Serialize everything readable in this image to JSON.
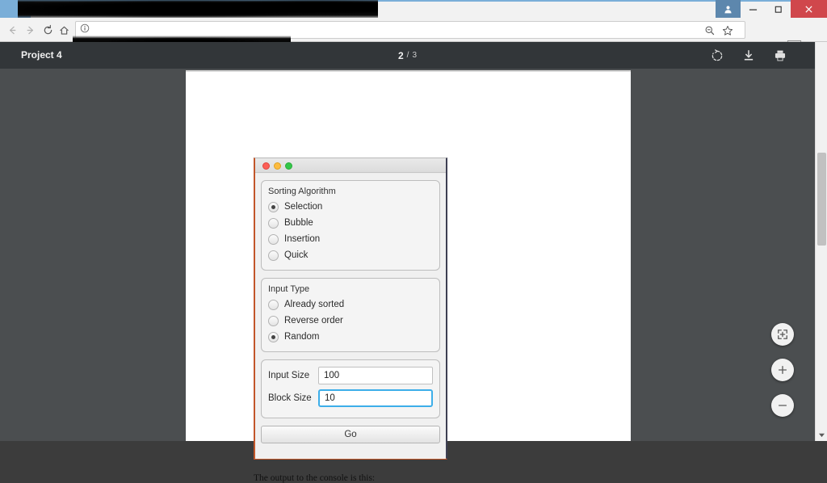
{
  "browser": {
    "tab": {
      "title": "",
      "favicon": "bookmark-icon",
      "redacted": true
    },
    "window_controls": {
      "profile": "profile-icon",
      "minimize": "–",
      "maximize": "❐",
      "close": "✕"
    },
    "toolbar": {
      "back": "back-arrow-icon",
      "forward": "forward-arrow-icon",
      "reload": "reload-icon",
      "home": "home-icon",
      "omnibox_url": "",
      "omnibox_info": "info-icon",
      "zoom_out_indicator": "zoom-out-icon",
      "bookmark_star": "star-icon",
      "extension": "extension-icon",
      "menu": "kebab-menu-icon",
      "url_redacted": true
    }
  },
  "pdf_viewer": {
    "document_title": "Project 4",
    "page_current": "2",
    "page_separator": "/",
    "page_total": "3",
    "actions": {
      "rotate": "rotate-icon",
      "download": "download-icon",
      "print": "print-icon"
    },
    "zoom_controls": {
      "fit": "fit-to-page-icon",
      "zoom_in": "+",
      "zoom_out": "−"
    },
    "page_caption": "The output to the console is this:"
  },
  "app_dialog": {
    "titlebar": {
      "close": "close-traffic-light",
      "minimize": "minimize-traffic-light",
      "maximize": "maximize-traffic-light"
    },
    "sorting_algorithm": {
      "label": "Sorting Algorithm",
      "options": [
        {
          "label": "Selection",
          "selected": true
        },
        {
          "label": "Bubble",
          "selected": false
        },
        {
          "label": "Insertion",
          "selected": false
        },
        {
          "label": "Quick",
          "selected": false
        }
      ]
    },
    "input_type": {
      "label": "Input Type",
      "options": [
        {
          "label": "Already sorted",
          "selected": false
        },
        {
          "label": "Reverse order",
          "selected": false
        },
        {
          "label": "Random",
          "selected": true
        }
      ]
    },
    "fields": [
      {
        "label": "Input Size",
        "value": "100",
        "focused": false
      },
      {
        "label": "Block Size",
        "value": "10",
        "focused": true
      }
    ],
    "submit_button": "Go"
  },
  "colors": {
    "browser_frame": "#7aaed8",
    "close_button": "#d0474c",
    "pdf_toolbar": "#323639",
    "pdf_background": "#4b4e50",
    "focus_accent": "#3daee9",
    "screenshot_edge": "#c2562a"
  }
}
